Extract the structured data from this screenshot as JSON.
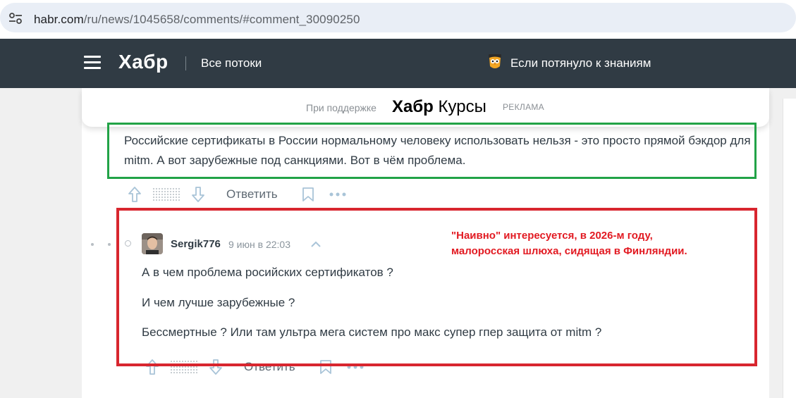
{
  "browser": {
    "url_host": "habr.com",
    "url_path": "/ru/news/1045658/comments/#comment_30090250",
    "site_info_icon": "tune-icon"
  },
  "header": {
    "menu_icon": "hamburger-icon",
    "logo": "Хабр",
    "all_flows": "Все потоки",
    "promo_icon": "owl-mascot-icon",
    "promo_text": "Если потянуло к знаниям"
  },
  "sponsor": {
    "pre": "При поддержке",
    "logo_bold": "Хабр",
    "logo_rest": " Курсы",
    "ad_label": "РЕКЛАМА"
  },
  "comment_parent": {
    "text": "Российские сертификаты в России нормальному человеку использовать нельзя - это просто прямой бэкдор для mitm. А вот зарубежные под санкциями. Вот в чём проблема.",
    "reply_label": "Ответить"
  },
  "comment_reply": {
    "username": "Sergik776",
    "timestamp": "9 июн в 22:03",
    "line1": "А в чем проблема росийских сертификатов ?",
    "line2": "И чем лучше зарубежные ?",
    "line3": "Бессмертные ? Или там ультра мега систем про макс супер гпер защита от mitm ?",
    "reply_label": "Ответить"
  },
  "annotation": {
    "line1": "\"Наивно\" интересуется, в 2026-м году,",
    "line2": "малоросская шлюха, сидящая в Финляндии."
  },
  "colors": {
    "green_frame": "#22a347",
    "red_frame": "#d8262f",
    "annotation_text": "#e21a22",
    "header_bg": "#303b44"
  }
}
